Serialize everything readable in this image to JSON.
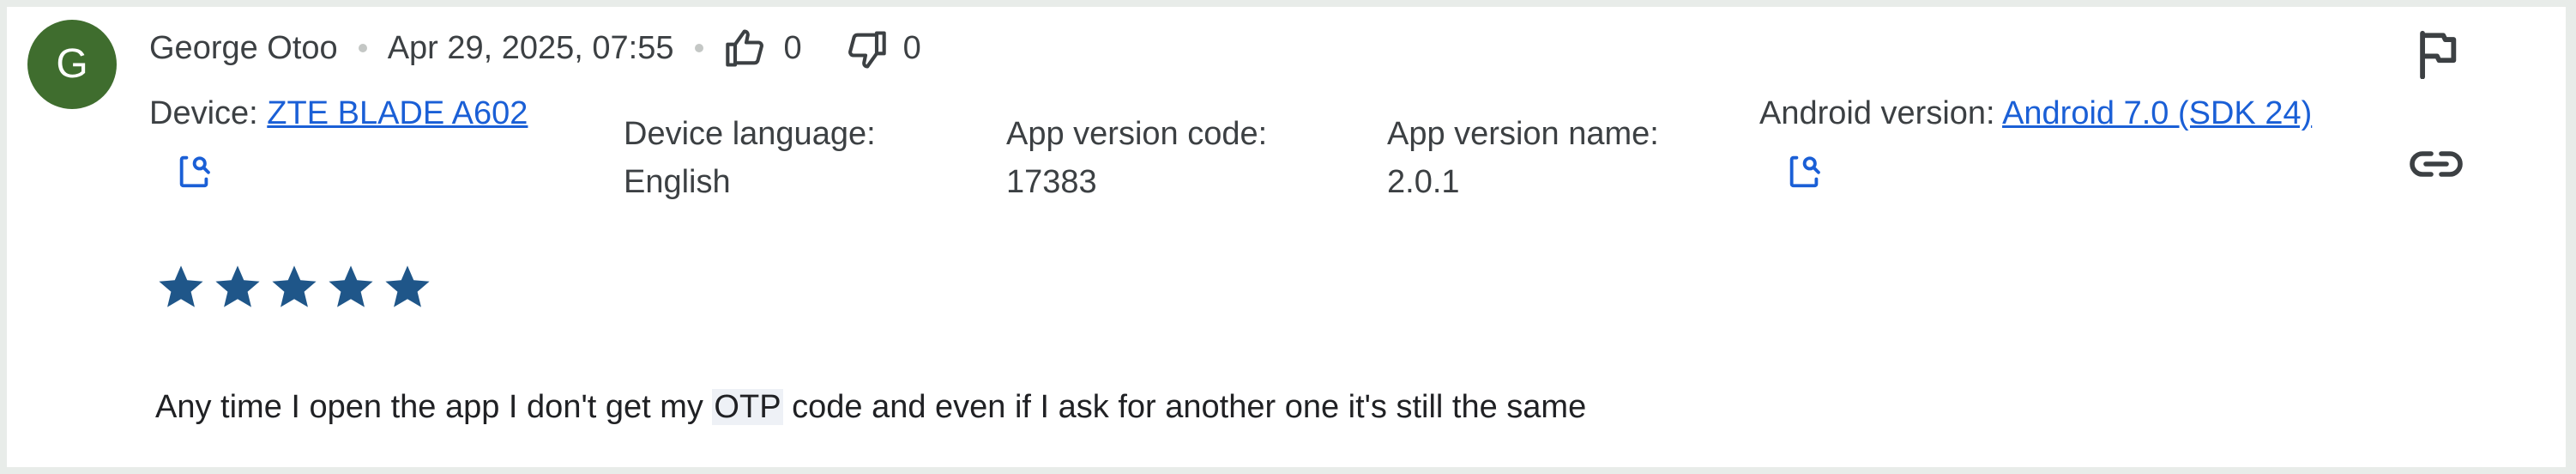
{
  "review": {
    "avatar_letter": "G",
    "reviewer_name": "George Otoo",
    "timestamp": "Apr 29, 2025, 07:55",
    "thumbs_up_count": "0",
    "thumbs_down_count": "0",
    "rating": 5,
    "text_before": "Any time I open the app I don't get my ",
    "text_highlight": "OTP",
    "text_after": " code and even if I ask for another one it's still the same"
  },
  "details": {
    "device_label": "Device: ",
    "device_value": "ZTE BLADE A602",
    "language_label": "Device language:",
    "language_value": "English",
    "version_code_label": "App version code:",
    "version_code_value": "17383",
    "version_name_label": "App version name:",
    "version_name_value": "2.0.1",
    "android_label": "Android version: ",
    "android_value": "Android 7.0 (SDK 24)"
  },
  "icons": {
    "thumbs_up": "thumb-up-icon",
    "thumbs_down": "thumb-down-icon",
    "device_search": "search-device-icon",
    "android_search": "search-device-icon",
    "flag": "flag-icon",
    "link": "link-icon",
    "star": "star-icon"
  },
  "colors": {
    "avatar_bg": "#3f6d2e",
    "star": "#1f5689",
    "link": "#1a5fd6"
  }
}
